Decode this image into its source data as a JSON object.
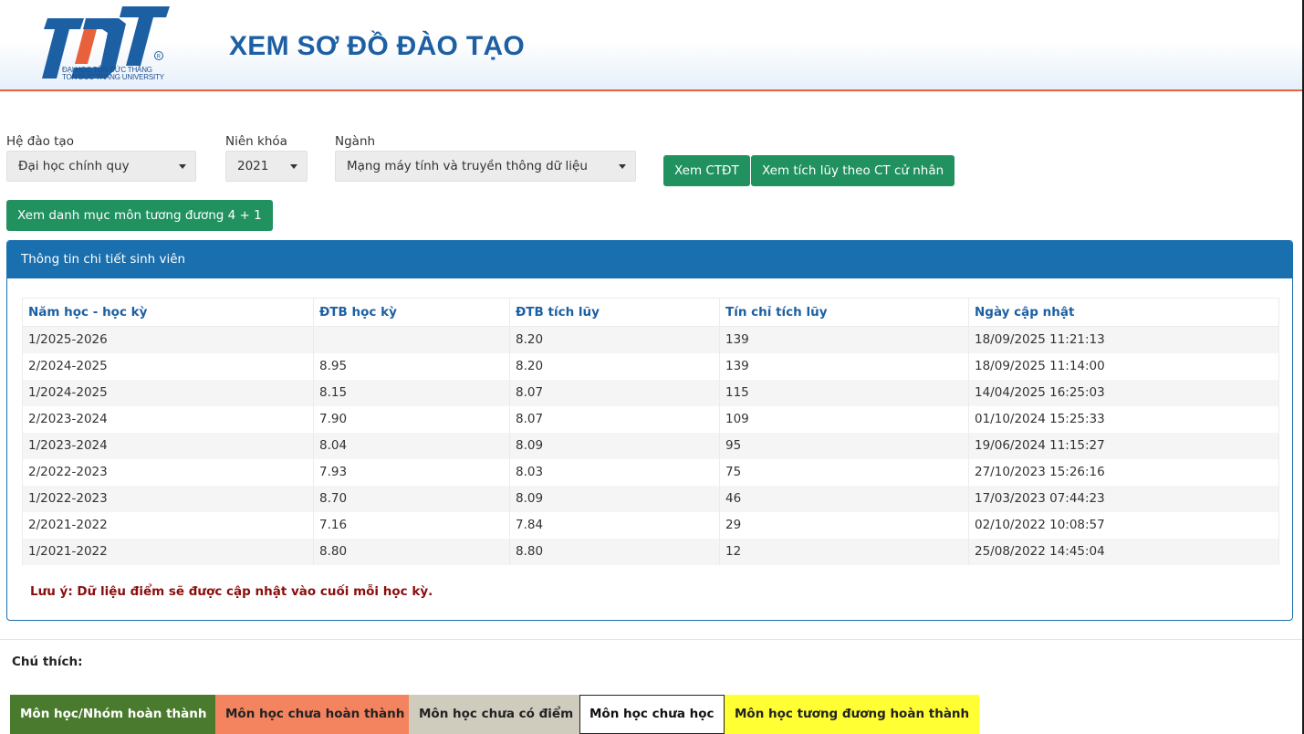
{
  "header": {
    "title": "XEM SƠ ĐỒ ĐÀO TẠO",
    "logo_text": "TĐT",
    "logo_sub1": "ĐẠI HỌC TÔN ĐỨC THẮNG",
    "logo_sub2": "TON DUC THANG UNIVERSITY",
    "logo_icon": "tdt-university-logo",
    "colors": {
      "title": "#1d5fa3",
      "accent_line": "#e8613c"
    }
  },
  "filters": {
    "he_dao_tao": {
      "label": "Hệ đào tạo",
      "value": "Đại học chính quy"
    },
    "nien_khoa": {
      "label": "Niên khóa",
      "value": "2021"
    },
    "nganh": {
      "label": "Ngành",
      "value": "Mạng máy tính và truyền thông dữ liệu"
    }
  },
  "buttons": {
    "xem_ctdt": "Xem CTĐT",
    "xem_tich_luy": "Xem tích lũy theo CT cử nhân",
    "xem_danh_muc": "Xem danh mục môn tương đương 4 + 1",
    "color": "#20915f"
  },
  "panel": {
    "heading": "Thông tin chi tiết sinh viên",
    "color": "#1a6faf",
    "columns": [
      "Năm học - học kỳ",
      "ĐTB học kỳ",
      "ĐTB tích lũy",
      "Tín chỉ tích lũy",
      "Ngày cập nhật"
    ],
    "rows": [
      [
        "1/2025-2026",
        "",
        "8.20",
        "139",
        "18/09/2025 11:21:13"
      ],
      [
        "2/2024-2025",
        "8.95",
        "8.20",
        "139",
        "18/09/2025 11:14:00"
      ],
      [
        "1/2024-2025",
        "8.15",
        "8.07",
        "115",
        "14/04/2025 16:25:03"
      ],
      [
        "2/2023-2024",
        "7.90",
        "8.07",
        "109",
        "01/10/2024 15:25:33"
      ],
      [
        "1/2023-2024",
        "8.04",
        "8.09",
        "95",
        "19/06/2024 11:15:27"
      ],
      [
        "2/2022-2023",
        "7.93",
        "8.03",
        "75",
        "27/10/2023 15:26:16"
      ],
      [
        "1/2022-2023",
        "8.70",
        "8.09",
        "46",
        "17/03/2023 07:44:23"
      ],
      [
        "2/2021-2022",
        "7.16",
        "7.84",
        "29",
        "02/10/2022 10:08:57"
      ],
      [
        "1/2021-2022",
        "8.80",
        "8.80",
        "12",
        "25/08/2022 14:45:04"
      ]
    ],
    "note": "Lưu ý: Dữ liệu điểm sẽ được cập nhật vào cuối mỗi học kỳ."
  },
  "legend": {
    "title": "Chú thích:",
    "items": [
      {
        "label": "Môn học/Nhóm hoàn thành",
        "bg": "#4a7a2e",
        "fg": "#ffffff",
        "border": "#4a7a2e"
      },
      {
        "label": "Môn học chưa hoàn thành",
        "bg": "#f4845f",
        "fg": "#222222",
        "border": "#f4845f"
      },
      {
        "label": "Môn học chưa có điểm",
        "bg": "#cfcbbd",
        "fg": "#222222",
        "border": "#cfcbbd"
      },
      {
        "label": "Môn học chưa học",
        "bg": "#ffffff",
        "fg": "#111111",
        "border": "#222222"
      },
      {
        "label": "Môn học tương đương hoàn thành",
        "bg": "#ffff33",
        "fg": "#222222",
        "border": "#ffff33"
      }
    ]
  }
}
